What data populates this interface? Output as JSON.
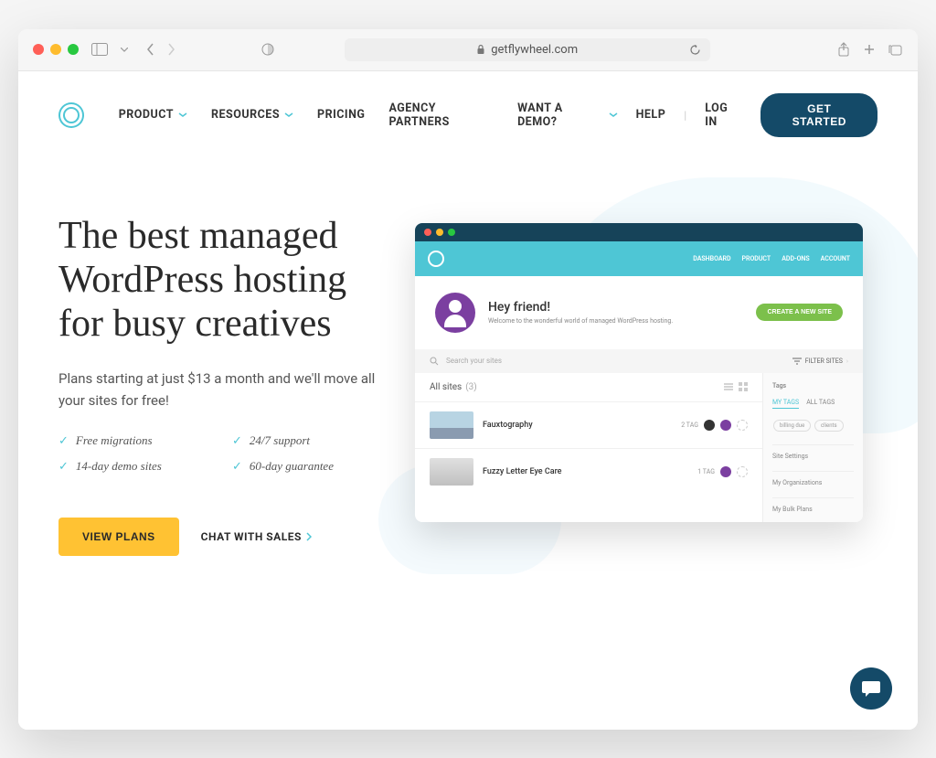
{
  "browser": {
    "url": "getflywheel.com"
  },
  "nav": {
    "items": [
      "PRODUCT",
      "RESOURCES",
      "PRICING",
      "AGENCY PARTNERS"
    ],
    "right": {
      "demo": "WANT A DEMO?",
      "help": "HELP",
      "login": "LOG IN",
      "cta": "GET STARTED"
    }
  },
  "hero": {
    "title": "The best managed WordPress hosting for busy creatives",
    "subtitle": "Plans starting at just $13 a month and we'll move all your sites for free!",
    "features": [
      "Free migrations",
      "24/7 support",
      "14-day demo sites",
      "60-day guarantee"
    ],
    "view_plans": "VIEW PLANS",
    "chat": "CHAT WITH SALES"
  },
  "dashboard": {
    "nav": [
      "DASHBOARD",
      "PRODUCT",
      "ADD-ONS",
      "ACCOUNT"
    ],
    "greeting": "Hey friend!",
    "welcome_sub": "Welcome to the wonderful world of managed WordPress hosting.",
    "create": "CREATE A NEW SITE",
    "search_placeholder": "Search your sites",
    "filter": "FILTER SITES",
    "all_sites": "All sites",
    "site_count": "(3)",
    "sites": [
      {
        "name": "Fauxtography",
        "tags": "2 TAG"
      },
      {
        "name": "Fuzzy Letter Eye Care",
        "tags": "1 TAG"
      }
    ],
    "tags": {
      "header": "Tags",
      "tabs": [
        "MY TAGS",
        "ALL TAGS"
      ],
      "pills": [
        "billing due",
        "clients"
      ],
      "sections": [
        "Site Settings",
        "My Organizations",
        "My Bulk Plans"
      ]
    }
  }
}
